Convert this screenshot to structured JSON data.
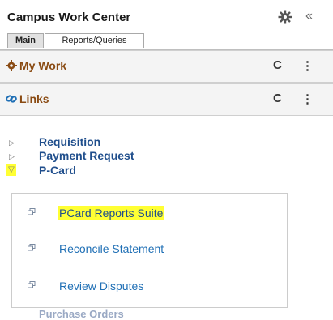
{
  "header": {
    "title": "Campus Work Center",
    "gear_icon": "gear-icon",
    "collapse_label": "«",
    "tabs": [
      {
        "label": "Main",
        "active": true
      },
      {
        "label": "Reports/Queries",
        "active": false
      }
    ]
  },
  "pagelets": [
    {
      "title": "My Work",
      "icon": "gear-icon",
      "refresh_label": "C",
      "menu_label": "⋮"
    },
    {
      "title": "Links",
      "icon": "link-icon",
      "refresh_label": "C",
      "menu_label": "⋮"
    }
  ],
  "tree": {
    "items": [
      {
        "label": "Requisition",
        "expanded": false,
        "arrow": "▷"
      },
      {
        "label": "Payment Request",
        "expanded": false,
        "arrow": "▷"
      },
      {
        "label": "P-Card",
        "expanded": true,
        "arrow": "▽"
      }
    ],
    "pcard_links": [
      {
        "label": "PCard Reports Suite",
        "highlighted": true
      },
      {
        "label": "Reconcile Statement",
        "highlighted": false
      },
      {
        "label": "Review Disputes",
        "highlighted": false
      }
    ],
    "next_item_partial": "Purchase Orders"
  },
  "colors": {
    "pagelet_title": "#8a4b13",
    "tree_label": "#1f4e8c",
    "link": "#1f6fb5",
    "highlight": "#ffff33"
  }
}
